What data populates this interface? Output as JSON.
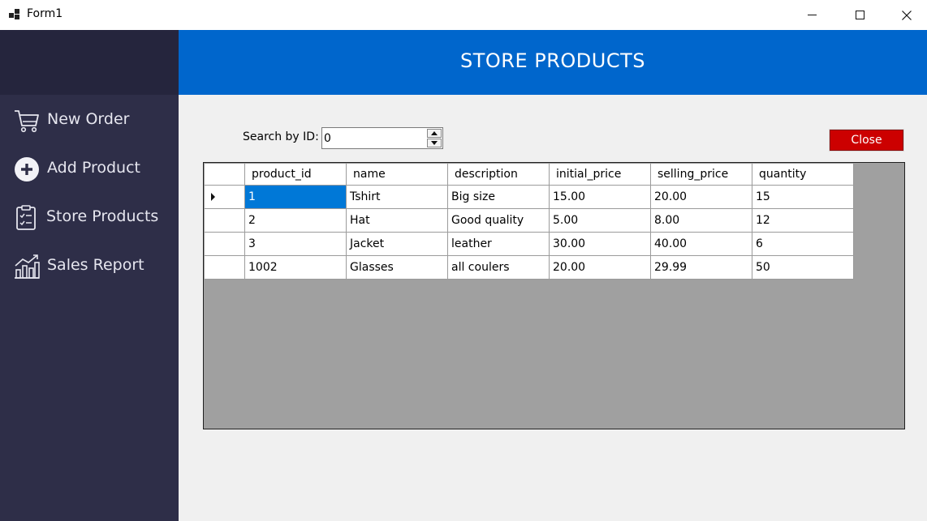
{
  "window": {
    "title": "Form1",
    "close_glyph": "✕"
  },
  "sidebar": {
    "items": [
      {
        "label": "New Order",
        "icon": "cart-icon"
      },
      {
        "label": "Add Product",
        "icon": "plus-circle-icon"
      },
      {
        "label": "Store Products",
        "icon": "clipboard-icon"
      },
      {
        "label": "Sales Report",
        "icon": "chart-icon"
      }
    ]
  },
  "header": {
    "title": "STORE PRODUCTS",
    "color": "#0066cc"
  },
  "search": {
    "label": "Search by ID:",
    "value": "0"
  },
  "close_button": {
    "label": "Close",
    "color": "#cc0000"
  },
  "table": {
    "columns": [
      "product_id",
      "name",
      "description",
      "initial_price",
      "selling_price",
      "quantity"
    ],
    "rows": [
      [
        "1",
        "Tshirt",
        "Big size",
        "15.00",
        "20.00",
        "15"
      ],
      [
        "2",
        "Hat",
        "Good quality",
        "5.00",
        "8.00",
        "12"
      ],
      [
        "3",
        "Jacket",
        "leather",
        "30.00",
        "40.00",
        "6"
      ],
      [
        "1002",
        "Glasses",
        "all coulers",
        "20.00",
        "29.99",
        "50"
      ]
    ],
    "selected_row": 0
  }
}
